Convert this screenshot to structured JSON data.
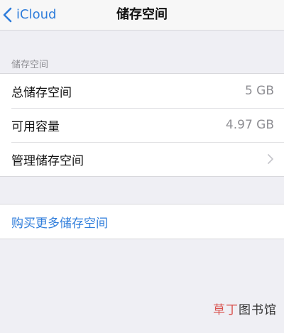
{
  "navbar": {
    "back_label": "iCloud",
    "title": "储存空间"
  },
  "section": {
    "header": "储存空间",
    "rows": [
      {
        "label": "总储存空间",
        "value": "5 GB"
      },
      {
        "label": "可用容量",
        "value": "4.97 GB"
      },
      {
        "label": "管理储存空间",
        "value": ""
      }
    ]
  },
  "buy": {
    "label": "购买更多储存空间"
  },
  "watermark": {
    "accent_text": "草丁",
    "text": "图书馆"
  },
  "colors": {
    "accent": "#2f7ddb",
    "background": "#efeff4",
    "secondary_text": "#8e8e93",
    "watermark_accent": "#d9534f"
  },
  "icons": {
    "back": "chevron-left-icon",
    "disclosure": "chevron-right-icon"
  }
}
